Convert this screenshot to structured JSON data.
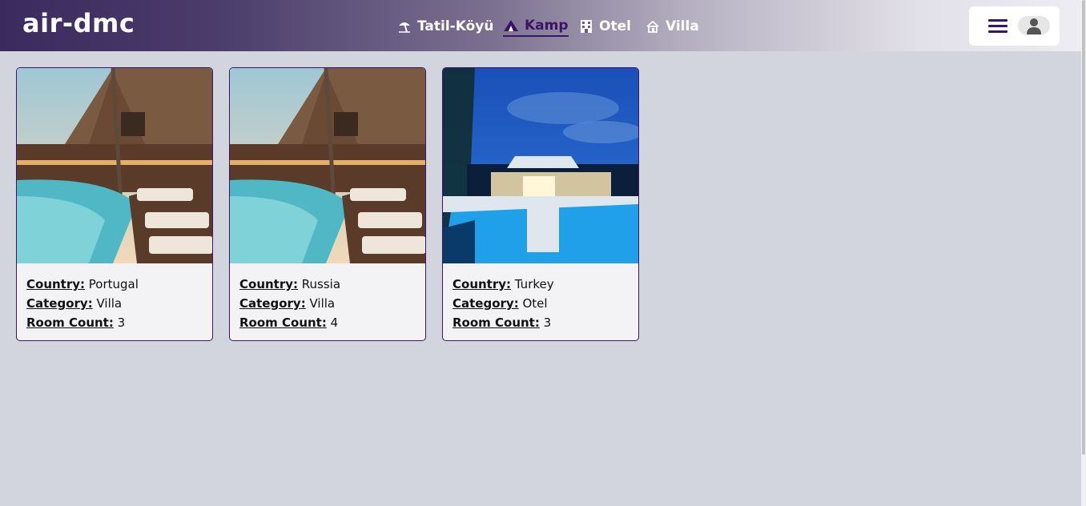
{
  "header": {
    "logo": "air-dmc",
    "nav": [
      {
        "label": "Tatil-Köyü",
        "icon": "beach-umbrella-icon"
      },
      {
        "label": "Kamp",
        "icon": "tent-icon",
        "active": true
      },
      {
        "label": "Otel",
        "icon": "hotel-building-icon"
      },
      {
        "label": "Villa",
        "icon": "villa-house-icon"
      }
    ],
    "menu_icon": "hamburger-menu-icon",
    "user_icon": "user-avatar-icon"
  },
  "labels": {
    "country": "Country:",
    "category": "Category:",
    "room_count": "Room Count:"
  },
  "cards": [
    {
      "country": "Portugal",
      "category": "Villa",
      "room_count": "3",
      "image": "resort-pool-deck-photo"
    },
    {
      "country": "Russia",
      "category": "Villa",
      "room_count": "4",
      "image": "resort-pool-deck-photo"
    },
    {
      "country": "Turkey",
      "category": "Otel",
      "room_count": "3",
      "image": "night-hotel-pool-photo"
    }
  ],
  "colors": {
    "accent": "#3b1466",
    "background": "#d3d5de"
  }
}
